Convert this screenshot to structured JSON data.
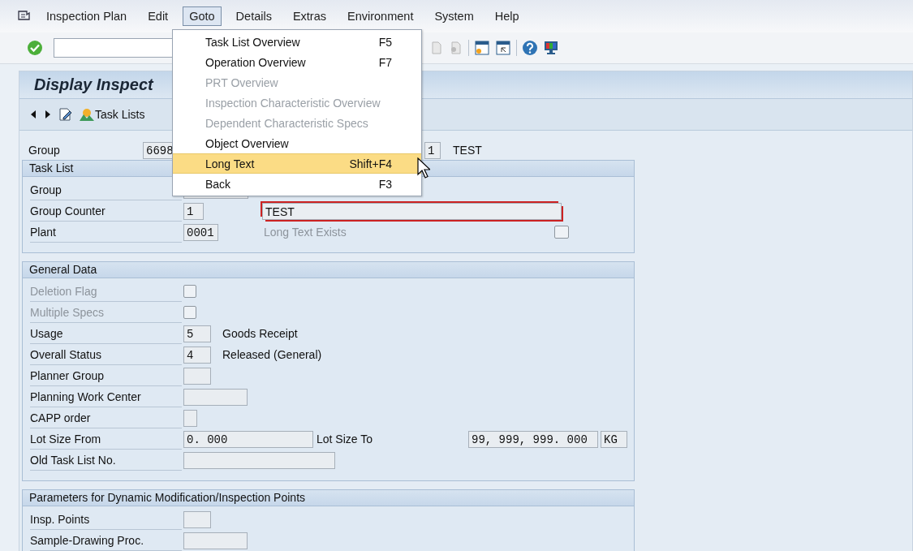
{
  "menu_bar": [
    {
      "label": "Inspection Plan",
      "selected": false
    },
    {
      "label": "Edit",
      "selected": false
    },
    {
      "label": "Goto",
      "selected": true
    },
    {
      "label": "Details",
      "selected": false
    },
    {
      "label": "Extras",
      "selected": false
    },
    {
      "label": "Environment",
      "selected": false
    },
    {
      "label": "System",
      "selected": false
    },
    {
      "label": "Help",
      "selected": false
    }
  ],
  "title": "Display Inspect",
  "app_toolbar": {
    "task_lists": "Task Lists"
  },
  "header": {
    "label": "Group",
    "group": "6698",
    "counter": "1",
    "description": "TEST"
  },
  "groups": [
    {
      "title": "Task List",
      "rows": [
        {
          "label": "Group",
          "disabled": false,
          "kind": "field",
          "value": ""
        },
        {
          "label": "Group Counter",
          "disabled": false,
          "kind": "field",
          "value": "1",
          "after": [
            {
              "kind": "required",
              "value": "TEST"
            }
          ]
        },
        {
          "label": "Plant",
          "disabled": false,
          "kind": "field",
          "value": "0001",
          "after": [
            {
              "kind": "label",
              "value": "Long Text Exists",
              "disabled": true
            },
            {
              "kind": "checkbox",
              "checked": false
            }
          ]
        }
      ]
    },
    {
      "title": "General Data",
      "rows": [
        {
          "label": "Deletion Flag",
          "disabled": true,
          "kind": "checkbox",
          "checked": false
        },
        {
          "label": "Multiple Specs",
          "disabled": true,
          "kind": "checkbox",
          "checked": false
        },
        {
          "label": "Usage",
          "disabled": false,
          "kind": "field",
          "value": "5",
          "after": [
            {
              "kind": "text",
              "value": "Goods Receipt"
            }
          ]
        },
        {
          "label": "Overall Status",
          "disabled": false,
          "kind": "field",
          "value": "4",
          "after": [
            {
              "kind": "text",
              "value": "Released (General)"
            }
          ]
        },
        {
          "label": "Planner Group",
          "disabled": false,
          "kind": "field",
          "value": ""
        },
        {
          "label": "Planning Work Center",
          "disabled": false,
          "kind": "field",
          "value": ""
        },
        {
          "label": "CAPP order",
          "disabled": false,
          "kind": "field",
          "value": ""
        },
        {
          "label": "Lot Size From",
          "disabled": false,
          "kind": "field",
          "value": "0. 000",
          "after": [
            {
              "kind": "label",
              "value": "Lot Size To",
              "disabled": false
            },
            {
              "kind": "field",
              "value": "99, 999, 999. 000"
            },
            {
              "kind": "field",
              "value": "KG"
            }
          ]
        },
        {
          "label": "Old Task List No.",
          "disabled": false,
          "kind": "field",
          "value": ""
        }
      ]
    },
    {
      "title": "Parameters for Dynamic Modification/Inspection Points",
      "rows": [
        {
          "label": "Insp. Points",
          "disabled": false,
          "kind": "field",
          "value": ""
        },
        {
          "label": "Sample-Drawing Proc.",
          "disabled": false,
          "kind": "field",
          "value": ""
        }
      ]
    }
  ],
  "dropdown": [
    {
      "label": "Task List Overview",
      "shortcut": "F5",
      "disabled": false,
      "selected": false
    },
    {
      "label": "Operation Overview",
      "shortcut": "F7",
      "disabled": false,
      "selected": false
    },
    {
      "label": "PRT Overview",
      "disabled": true,
      "selected": false
    },
    {
      "label": "Inspection Characteristic Overview",
      "disabled": true,
      "selected": false
    },
    {
      "label": "Dependent Characteristic Specs",
      "disabled": true,
      "selected": false
    },
    {
      "label": "Object Overview",
      "disabled": false,
      "selected": false
    },
    {
      "label": "Long Text",
      "shortcut": "Shift+F4",
      "disabled": false,
      "selected": true
    },
    {
      "label": "Back",
      "shortcut": "F3",
      "disabled": false,
      "selected": false
    }
  ]
}
